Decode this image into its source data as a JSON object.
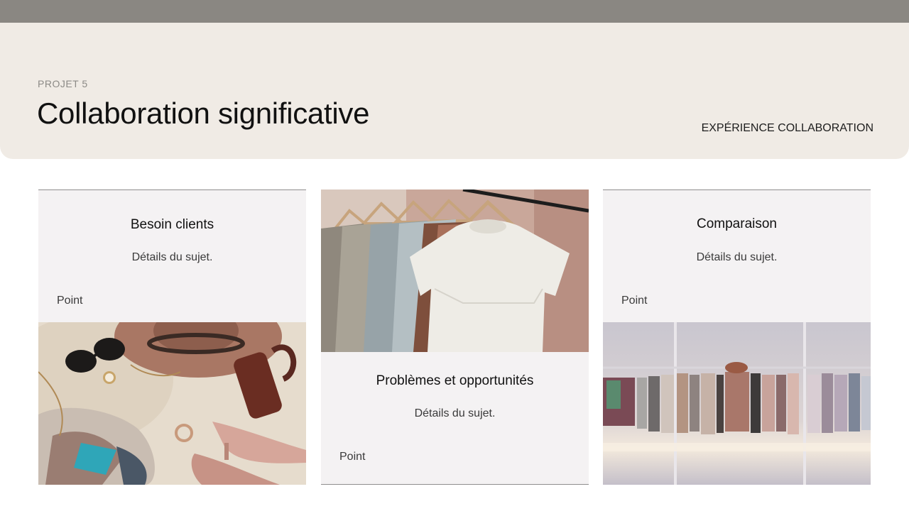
{
  "header": {
    "eyebrow": "PROJET 5",
    "title": "Collaboration significative",
    "category": "EXPÉRIENCE COLLABORATION"
  },
  "cards": [
    {
      "heading": "Besoin clients",
      "details": "Détails du sujet.",
      "point": "Point"
    },
    {
      "heading": "Problèmes et opportunités",
      "details": "Détails du sujet.",
      "point": "Point"
    },
    {
      "heading": "Comparaison",
      "details": "Détails du sujet.",
      "point": "Point"
    }
  ],
  "colors": {
    "top_bar": "#8a8782",
    "hero_background": "#f0ebe5",
    "card_background": "#f4f2f3"
  }
}
